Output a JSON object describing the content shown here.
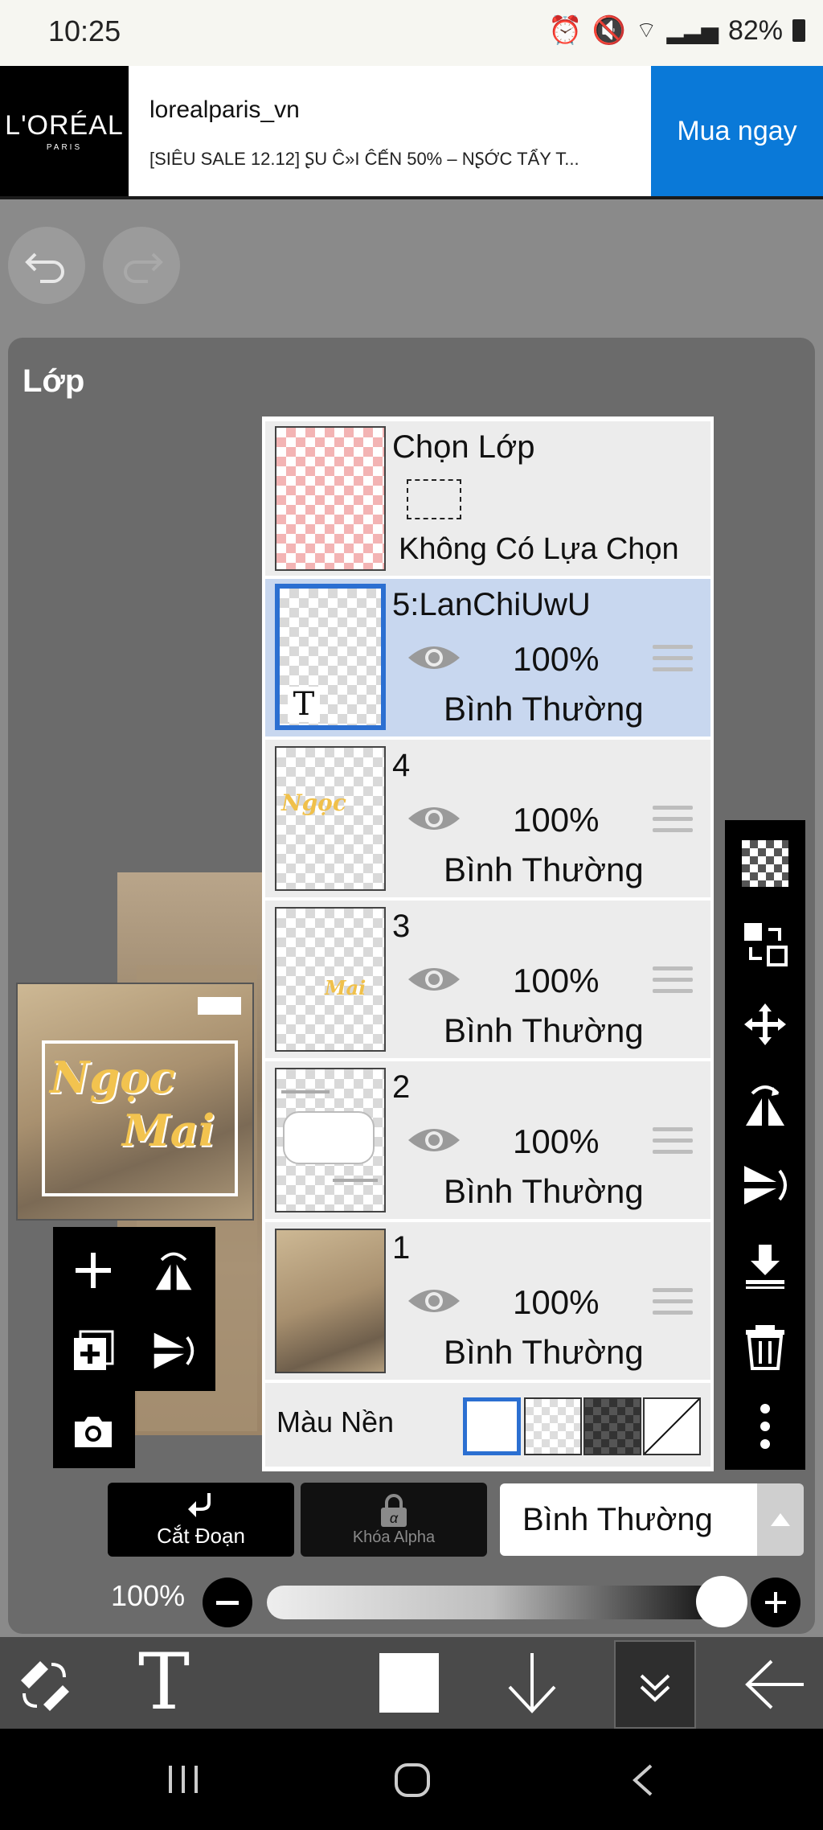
{
  "status_bar": {
    "time": "10:25",
    "battery": "82%"
  },
  "ad": {
    "logo_text": "L'ORÉAL",
    "logo_sub": "PARIS",
    "handle": "lorealparis_vn",
    "description": "[SIÊU SALE 12.12] ꟅU Ĉ»I ĈẾN 50% –  NꟅỚC TẨY T...",
    "cta": "Mua ngay"
  },
  "panel": {
    "title": "Lớp"
  },
  "selection_layer": {
    "title": "Chọn Lớp",
    "subtitle": "Không Có Lựa Chọn"
  },
  "layers": [
    {
      "name": "5:LanChiUwU",
      "opacity": "100%",
      "mode": "Bình Thường",
      "selected": true,
      "text_glyph": "T"
    },
    {
      "name": "4",
      "opacity": "100%",
      "mode": "Bình Thường",
      "selected": false
    },
    {
      "name": "3",
      "opacity": "100%",
      "mode": "Bình Thường",
      "selected": false
    },
    {
      "name": "2",
      "opacity": "100%",
      "mode": "Bình Thường",
      "selected": false
    },
    {
      "name": "1",
      "opacity": "100%",
      "mode": "Bình Thường",
      "selected": false
    }
  ],
  "background_color": {
    "label": "Màu Nền"
  },
  "controls": {
    "clip_label": "Cắt Đoạn",
    "alpha_lock_label": "Khóa Alpha",
    "blend_mode": "Bình Thường",
    "opacity_value": "100%",
    "opacity_fraction": 1.0
  },
  "preview": {
    "art_text_1": "Ngọc",
    "art_text_2": "Mai"
  },
  "colors": {
    "accent": "#2b6fd1",
    "selected_row": "#c8d7ef",
    "ad_cta": "#0a79d8"
  }
}
